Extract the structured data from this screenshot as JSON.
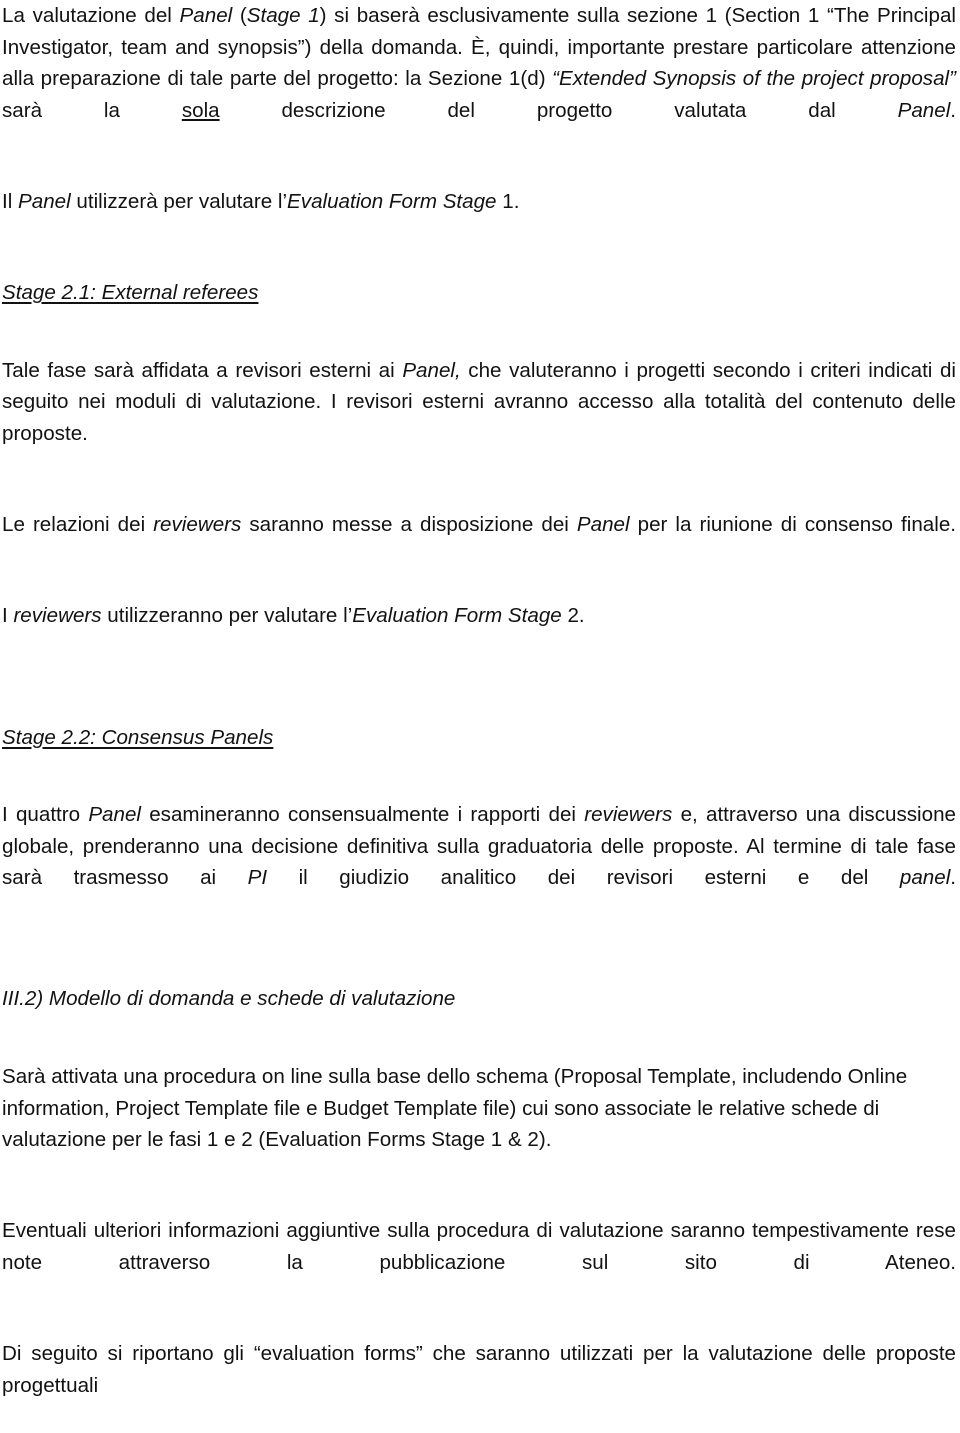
{
  "document": {
    "language": "it",
    "text_color": "#121212",
    "background_color": "#ffffff",
    "paragraphs": {
      "p1": {
        "s1": "La valutazione del ",
        "s2_it": "Panel",
        "s3": " (",
        "s4_it": "Stage 1",
        "s5": ") si baserà esclusivamente sulla sezione 1 (Section 1 “The Principal Investigator, team and synopsis”) della domanda. È, quindi, importante prestare particolare attenzione alla preparazione di tale parte del progetto: la Sezione 1(d) ",
        "s6_it": "“Extended Synopsis of the project proposal”",
        "s7": " sarà la ",
        "s8_ul": "sola",
        "s9": " descrizione del progetto valutata dal ",
        "s10_it": "Panel",
        "s11": "."
      },
      "p2": {
        "s1": "Il ",
        "s2_it": "Panel",
        "s3": " utilizzerà per valutare l’",
        "s4_it": "Evaluation Form Stage",
        "s5": " 1."
      },
      "h1": "Stage 2.1: External referees",
      "p3": {
        "s1": "Tale fase sarà affidata a revisori esterni ai ",
        "s2_it": "Panel,",
        "s3": " che valuteranno i progetti secondo i criteri indicati di seguito nei moduli di valutazione. I revisori esterni avranno accesso alla totalità del contenuto delle proposte."
      },
      "p4": {
        "s1": "Le relazioni dei ",
        "s2_it": "reviewers",
        "s3": " saranno messe a disposizione dei ",
        "s4_it": "Panel",
        "s5": " per la riunione di consenso finale."
      },
      "p5": {
        "s1": "I ",
        "s2_it": "reviewers",
        "s3": " utilizzeranno per valutare l’",
        "s4_it": "Evaluation Form Stage",
        "s5": " 2."
      },
      "h2": "Stage 2.2: Consensus Panels",
      "p6": {
        "s1": "I quattro ",
        "s2_it": "Panel",
        "s3": " esamineranno consensualmente i rapporti dei ",
        "s4_it": "reviewers",
        "s5": " e, attraverso una discussione globale, prenderanno una decisione definitiva sulla graduatoria delle proposte. Al termine di tale fase sarà trasmesso ai ",
        "s6_it": "PI",
        "s7": " il giudizio analitico dei revisori esterni e del ",
        "s8_it": "panel",
        "s9": "."
      },
      "h3": "III.2)  Modello di domanda e schede di valutazione",
      "p7": {
        "s1": "Sarà attivata una procedura on line sulla base dello schema (Proposal Template, includendo Online information, Project Template file e Budget Template file) cui sono associate le relative schede di valutazione per le fasi 1 e 2 (Evaluation Forms Stage 1 & 2)."
      },
      "p8": {
        "s1": "Eventuali ulteriori informazioni aggiuntive sulla procedura di valutazione saranno tempestivamente rese note attraverso la pubblicazione sul sito di Ateneo."
      },
      "p9": {
        "s1": "Di seguito si riportano gli “evaluation forms” che saranno utilizzati per la valutazione delle proposte progettuali"
      }
    }
  }
}
